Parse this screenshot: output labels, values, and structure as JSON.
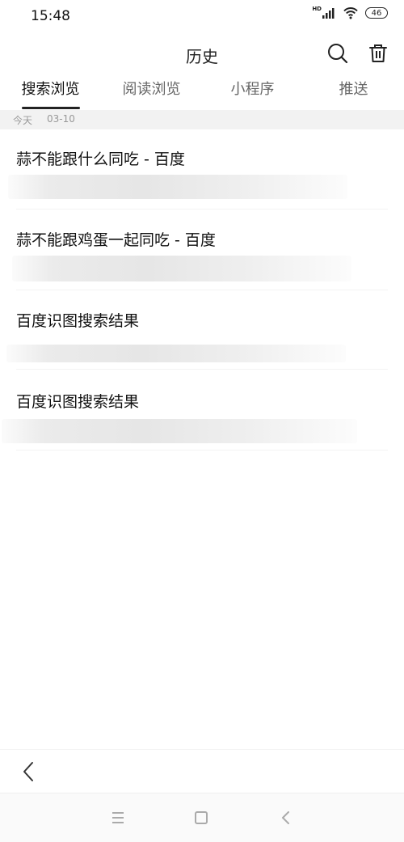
{
  "status": {
    "time": "15:48",
    "hd_label": "HD",
    "battery": "46"
  },
  "header": {
    "title": "历史"
  },
  "tabs": [
    {
      "label": "搜索浏览",
      "active": true
    },
    {
      "label": "阅读浏览",
      "active": false
    },
    {
      "label": "小程序",
      "active": false
    },
    {
      "label": "推送",
      "active": false
    }
  ],
  "date_strip": {
    "today": "今天",
    "date": "03-10"
  },
  "entries": [
    {
      "title": "蒜不能跟什么同吃 - 百度"
    },
    {
      "title": "蒜不能跟鸡蛋一起同吃 - 百度"
    },
    {
      "title": "百度识图搜索结果"
    },
    {
      "title": "百度识图搜索结果"
    }
  ],
  "icons": {
    "search": "search-icon",
    "delete": "trash-icon",
    "back": "back-arrow-icon",
    "menu": "menu-icon",
    "home": "home-square-icon",
    "sys_back": "chevron-left-icon"
  },
  "colors": {
    "text": "#222222",
    "muted": "#999999",
    "strip": "#f2f2f2"
  }
}
